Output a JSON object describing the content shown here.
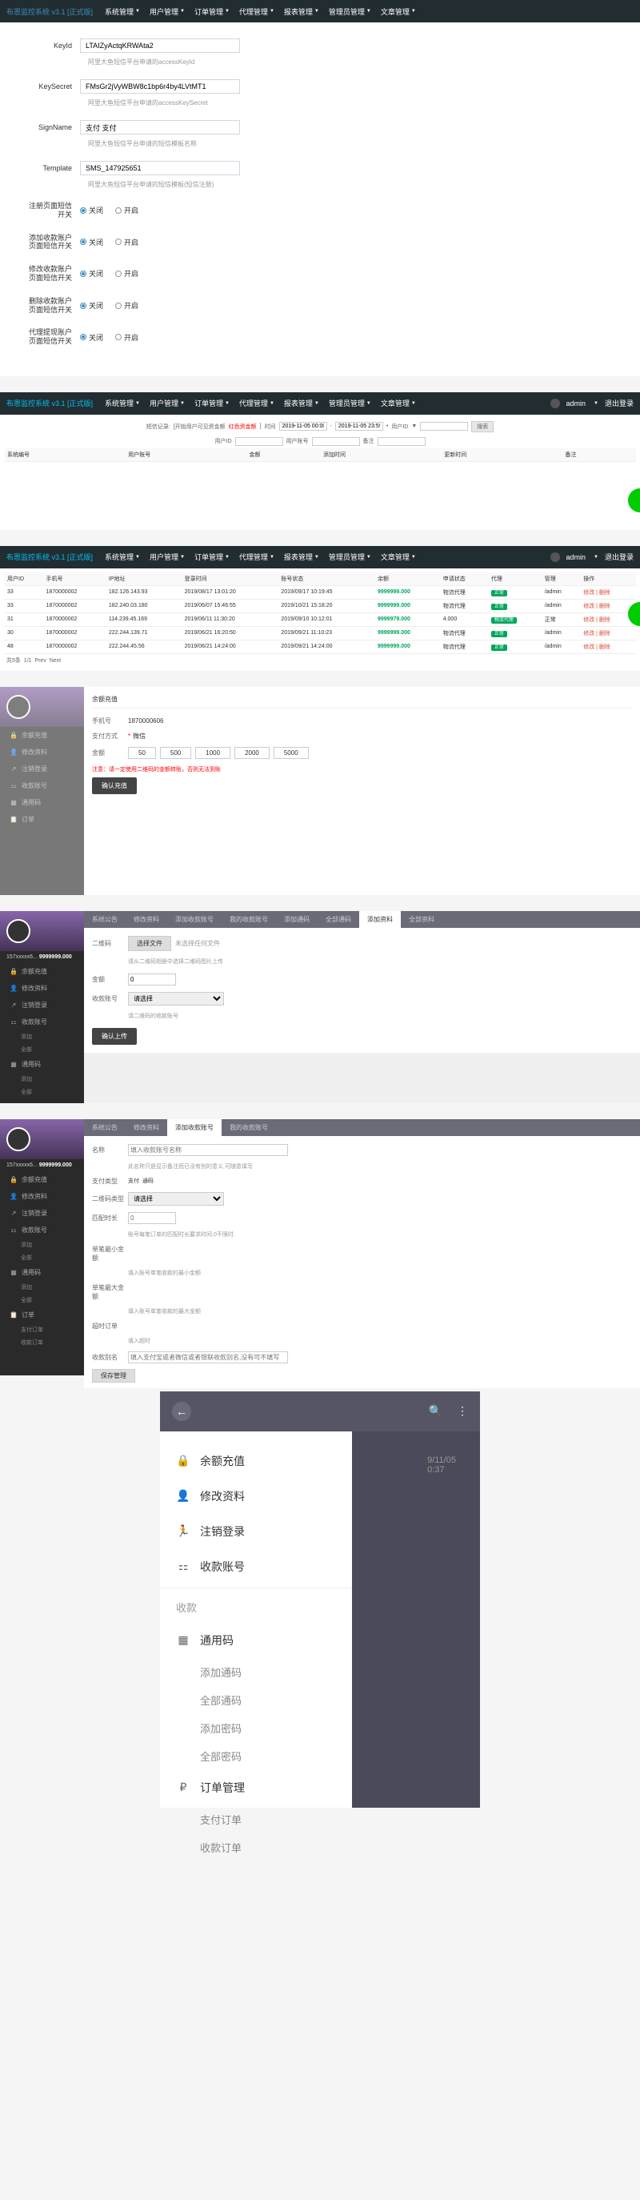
{
  "app_title": "布恩监控系统 v3.1 [正式版]",
  "nav": [
    "系统管理",
    "用户管理",
    "订单管理",
    "代理管理",
    "报表管理",
    "管理员管理",
    "文章管理"
  ],
  "nav_user": "admin",
  "nav_logout": "退出登录",
  "config": {
    "keyId": {
      "label": "KeyId",
      "value": "LTAIZyActqKRWAta2",
      "desc": "阿里大鱼短信平台申请的accessKeyId"
    },
    "keySecret": {
      "label": "KeySecret",
      "value": "FMsGr2jVyWBW8c1bp6r4by4LVtMT1",
      "desc": "阿里大鱼短信平台申请的accessKeySecret"
    },
    "signName": {
      "label": "SignName",
      "value": "支付 支付",
      "desc": "阿里大鱼短信平台申请的短信模板名称"
    },
    "template": {
      "label": "Template",
      "value": "SMS_147925651",
      "desc": "阿里大鱼短信平台申请的短信模板(短信注册)"
    },
    "switches": [
      {
        "label": "注册页面短信开关",
        "on": "关闭",
        "off": "开启"
      },
      {
        "label": "添加收款账户页面短信开关",
        "on": "关闭",
        "off": "开启"
      },
      {
        "label": "修改收款账户页面短信开关",
        "on": "关闭",
        "off": "开启"
      },
      {
        "label": "删除收款账户页面短信开关",
        "on": "关闭",
        "off": "开启"
      },
      {
        "label": "代理提现账户页面短信开关",
        "on": "关闭",
        "off": "开启"
      }
    ]
  },
  "search2": {
    "label1": "短信记录:",
    "label2": "[开始用户可见资金额",
    "red": "红色资金额",
    "label3": "]",
    "time": "时间",
    "date1": "2019-11-05 00:00:00",
    "date2": "2019-11-05 23:59:59",
    "type": "用户ID",
    "go": "搜索",
    "uid": "用户ID",
    "ph": "用户账号",
    "bz": "备注"
  },
  "tbl2_head": [
    "系统编号",
    "用户账号",
    "金额",
    "添加时间",
    "更新时间",
    "备注"
  ],
  "tbl3_head": [
    "用户ID",
    "手机号",
    "IP地址",
    "登录时间",
    "账号状态",
    "余额",
    "申请状态",
    "代理",
    "管理",
    "操作"
  ],
  "tbl3_rows": [
    {
      "id": "33",
      "phone": "1870000002",
      "ip": "182.126.143.93",
      "time": "2019/08/17 13:01:20",
      "status": "2019/09/17 10:19:45",
      "bal": "9999999.000",
      "state": "物流代理",
      "mgr": "正常",
      "admin": "/admin",
      "op": "修改 | 删除"
    },
    {
      "id": "33",
      "phone": "1870000002",
      "ip": "182.240.03.180",
      "time": "2019/06/07 15:46:55",
      "status": "2019/10/21 15:18:20",
      "bal": "9999999.000",
      "state": "物流代理",
      "mgr": "正常",
      "admin": "/admin",
      "op": "修改 | 删除"
    },
    {
      "id": "31",
      "phone": "1870000002",
      "ip": "114.239.45.169",
      "time": "2019/06/11 11:30:20",
      "status": "2019/09/10 10:12:01",
      "bal": "9999979.000",
      "state": "4.000",
      "mgr": "物流代理",
      "admin": "正常",
      "op": "修改 | 删除"
    },
    {
      "id": "30",
      "phone": "1870000002",
      "ip": "222.244.139.71",
      "time": "2019/06/21 16:20:50",
      "status": "2019/09/21 11:10:23",
      "bal": "9999999.000",
      "state": "物流代理",
      "mgr": "正常",
      "admin": "/admin",
      "op": "修改 | 删除"
    },
    {
      "id": "48",
      "phone": "1870000002",
      "ip": "222.244.45.56",
      "time": "2019/06/21 14:24:00",
      "status": "2019/09/21 14:24:00",
      "bal": "9999999.000",
      "state": "物流代理",
      "mgr": "正常",
      "admin": "/admin",
      "op": "修改 | 删除"
    }
  ],
  "pager": {
    "count": "共5条",
    "page": "1/1",
    "prev": "Prev",
    "next": "Next"
  },
  "mob_user": "157xxxxx6... ",
  "mob_bal": "9999999.000",
  "sb_items": {
    "recharge": "余额充值",
    "profile": "修改资料",
    "logout": "注销登录",
    "account": "收款账号",
    "sk": "收款",
    "tym": "通用码",
    "add": "添加",
    "all": "全部",
    "order": "订单",
    "pay": "支付订单",
    "rcv": "收款订单"
  },
  "recharge": {
    "title": "余额充值",
    "hand": "手机号",
    "hand_v": "1870000606",
    "method": "支付方式",
    "method_v": "微信",
    "amount": "金额",
    "amounts": [
      "50",
      "500",
      "1000",
      "2000",
      "5000"
    ],
    "note": "注意：请一定使用二维码的金额转账，否则无法到账",
    "confirm": "确认充值"
  },
  "tabs5": [
    "系统公告",
    "修改资料",
    "添加收款账号",
    "我的收款账号",
    "添加通码",
    "全部通码",
    "添加资料",
    "全部资料"
  ],
  "panel5": {
    "qr": "二维码",
    "choose": "选择文件",
    "nofile": "未选择任何文件",
    "tip": "请从二维码相册中选择二维码图片上传",
    "amount": "金额",
    "amt_v": "0",
    "account": "收款账号",
    "sel": "请选择",
    "ph": "请二维码的收款账号",
    "confirm": "确认上传"
  },
  "tabs6": [
    "系统公告",
    "修改资料",
    "添加收款账号",
    "我的收款账号"
  ],
  "panel6": {
    "name": "名称",
    "name_ph": "填入收款账号名称",
    "tip1": "此名称只是显示备注而已没有别的意义,可随意填写",
    "type": "支付类型",
    "t1": "支付",
    "t2": "通码",
    "qrtype": "二维码类型",
    "qrsel": "请选择",
    "fee": "匹配时长",
    "fee_ph": "0",
    "tip2": "账号每笔订单的匹配时长要求时间,0不限时.",
    "min": "单笔最小金额",
    "min_ph": "填入账号单笔收款的最小金额",
    "max": "单笔最大金额",
    "max_ph": "填入账号单笔收款的最大金额",
    "day": "超时订单",
    "day_ph": "填入超时",
    "alias": "收款别名",
    "alias_ph": "填入支付宝或者微信或者银联收款别名,没有可不填写",
    "save": "保存管理"
  },
  "drawer": {
    "back": "←",
    "search": "search",
    "more": "⋮",
    "peek_date": "9/11/05",
    "peek_time": "0:37",
    "items": {
      "recharge": "余额充值",
      "profile": "修改资料",
      "logout": "注销登录",
      "account": "收款账号"
    },
    "cat1": "收款",
    "cat2": "通用码",
    "sub_add": "添加通码",
    "sub_all": "全部通码",
    "sub_add2": "添加密码",
    "sub_all2": "全部密码",
    "cat3": "订单管理",
    "sub_pay": "支付订单",
    "sub_rcv": "收款订单"
  }
}
